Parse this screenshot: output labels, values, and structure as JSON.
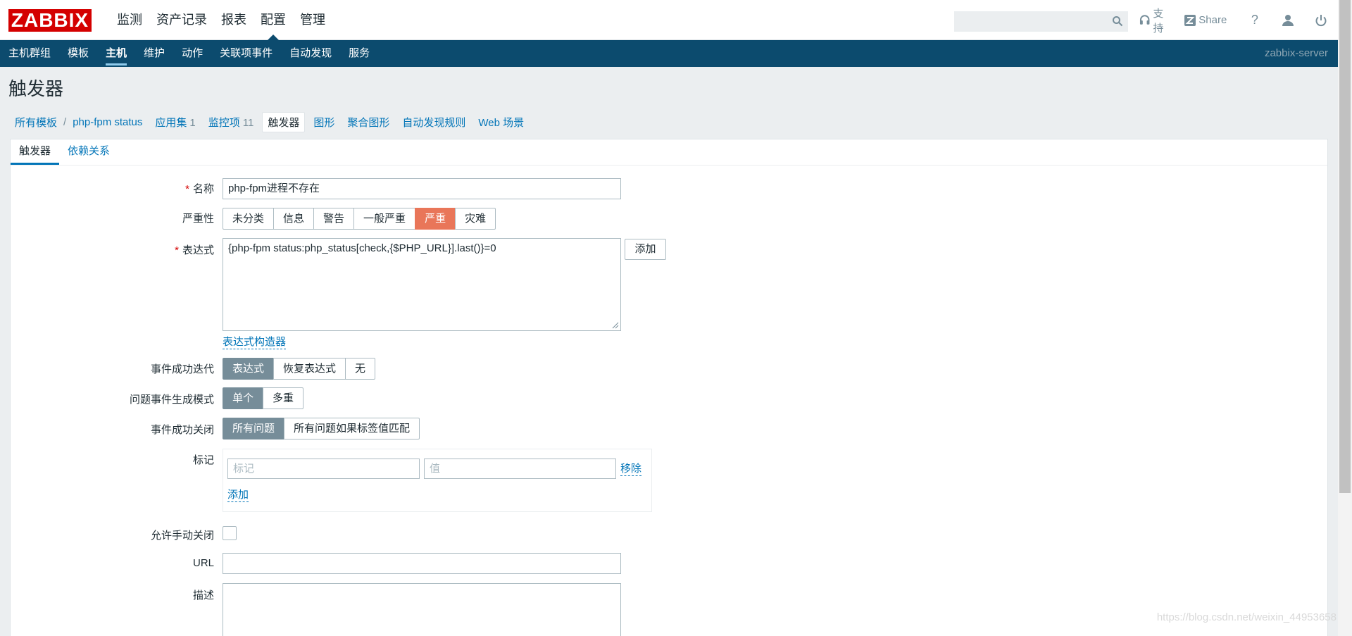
{
  "logo_text": "ZABBIX",
  "main_menu": [
    "监测",
    "资产记录",
    "报表",
    "配置",
    "管理"
  ],
  "main_menu_active": "配置",
  "search": {
    "placeholder": ""
  },
  "top_links": {
    "support": "支持",
    "share": "Share"
  },
  "sub_menu": [
    "主机群组",
    "模板",
    "主机",
    "维护",
    "动作",
    "关联项事件",
    "自动发现",
    "服务"
  ],
  "server_name": "zabbix-server",
  "page_title": "触发器",
  "breadcrumb": {
    "all_templates": "所有模板",
    "separator": "/",
    "template": "php-fpm status",
    "applications": "应用集",
    "applications_count": "1",
    "items": "监控项",
    "items_count": "11",
    "triggers": "触发器",
    "graphs": "图形",
    "screens": "聚合图形",
    "discovery": "自动发现规则",
    "web": "Web 场景"
  },
  "tabs": [
    "触发器",
    "依赖关系"
  ],
  "form": {
    "name_label": "名称",
    "name_value": "php-fpm进程不存在",
    "severity_label": "严重性",
    "severity_options": [
      "未分类",
      "信息",
      "警告",
      "一般严重",
      "严重",
      "灾难"
    ],
    "severity_selected": "严重",
    "expression_label": "表达式",
    "expression_value": "{php-fpm status:php_status[check,{$PHP_URL}].last()}=0",
    "expression_add": "添加",
    "expression_builder": "表达式构造器",
    "ok_event_label": "事件成功迭代",
    "ok_event_options": [
      "表达式",
      "恢复表达式",
      "无"
    ],
    "problem_mode_label": "问题事件生成模式",
    "problem_mode_options": [
      "单个",
      "多重"
    ],
    "ok_close_label": "事件成功关闭",
    "ok_close_options": [
      "所有问题",
      "所有问题如果标签值匹配"
    ],
    "tags_label": "标记",
    "tag_placeholder": "标记",
    "value_placeholder": "值",
    "tag_remove": "移除",
    "tag_add": "添加",
    "manual_close_label": "允许手动关闭",
    "url_label": "URL",
    "url_value": "",
    "description_label": "描述"
  },
  "watermark": "https://blog.csdn.net/weixin_44953658"
}
